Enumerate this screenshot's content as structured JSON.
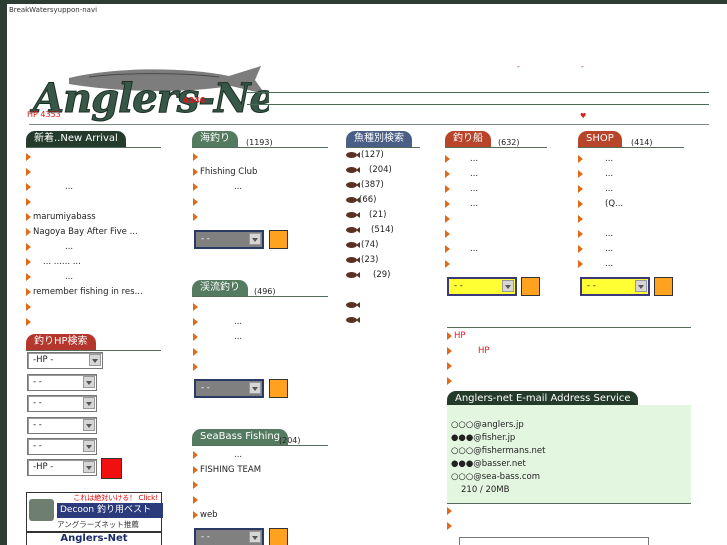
{
  "site": {
    "name": "BreakWatersyuppon-navi",
    "logo_text": "Anglers-Net",
    "logo_count": "4346",
    "hp_count": "HP 4353",
    "dash1": "-",
    "dash2": "-",
    "heart": "♥"
  },
  "colors": {
    "orange": "#e06a1a",
    "red": "#e0191b",
    "dark_green": "#243b2b"
  },
  "new_arrival": {
    "title": "新着..New Arrival",
    "items": [
      "",
      "",
      "...",
      "",
      "marumiyabass",
      "Nagoya Bay After Five ...",
      "...",
      "...    ...... ...",
      "...",
      "remember fishing in res...",
      "",
      ""
    ]
  },
  "hp_search": {
    "title": "釣りHP検索",
    "selects": [
      "-HP  -",
      "-    -",
      "-    -",
      "-    -",
      "-    -",
      "-HP  -"
    ]
  },
  "sea": {
    "title": "海釣り",
    "count": "(1193)",
    "items": [
      "",
      "Fhishing Club",
      "...",
      "",
      ""
    ],
    "select": "-   -"
  },
  "stream": {
    "title": "渓流釣り",
    "count": "(496)",
    "items": [
      "",
      "...",
      "...",
      "",
      ""
    ],
    "select": "-   -"
  },
  "seabass": {
    "title": "SeaBass Fishing",
    "count": "(204)",
    "items": [
      "...",
      "FISHING TEAM",
      "",
      "",
      "web"
    ],
    "select": "-   -"
  },
  "species": {
    "title": "魚種別検索",
    "items": [
      "(127)",
      "(204)",
      "(387)",
      "(66)",
      "(21)",
      "(514)",
      "(74)",
      "(23)",
      "(29)",
      "",
      ""
    ]
  },
  "boat": {
    "title": "釣り船",
    "count": "(632)",
    "items": [
      "...",
      "...",
      "...",
      "...",
      "",
      "",
      "...",
      ""
    ],
    "select": "-  -"
  },
  "shop": {
    "title": "SHOP",
    "count": "(414)",
    "items": [
      "...",
      "...",
      "...",
      "(Q...",
      "",
      "...",
      "...",
      "..."
    ],
    "select": "-   -"
  },
  "hp_links": {
    "items": [
      "HP",
      "HP",
      "",
      ""
    ]
  },
  "email": {
    "title": "Anglers-net E-mail Address Service",
    "lines": [
      "○○○@anglers.jp",
      "●●●@fisher.jp",
      "○○○@fishermans.net",
      "●●●@basser.net",
      "○○○@sea-bass.com",
      "210    /      20MB"
    ],
    "after": [
      "",
      ""
    ]
  },
  "banner": {
    "top": "これは絶対いける！ Click!",
    "mid": "Decoon 釣り用ベスト",
    "bottom": "アングラーズネット推薦"
  },
  "bottom_label": "Anglers-Net"
}
